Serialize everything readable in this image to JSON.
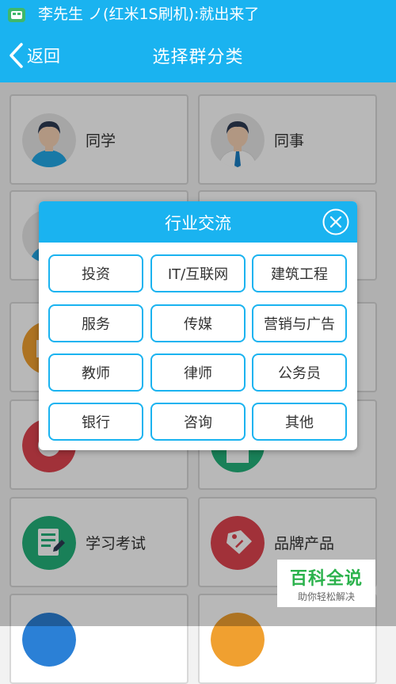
{
  "status_bar": {
    "notification": "李先生 ノ(红米1S刷机):就出来了"
  },
  "nav": {
    "back_label": "返回",
    "title": "选择群分类"
  },
  "categories": [
    {
      "label": "同学"
    },
    {
      "label": "同事"
    },
    {
      "label": "学习考试"
    },
    {
      "label": "品牌产品"
    }
  ],
  "dialog": {
    "title": "行业交流",
    "options": [
      "投资",
      "IT/互联网",
      "建筑工程",
      "服务",
      "传媒",
      "营销与广告",
      "教师",
      "律师",
      "公务员",
      "银行",
      "咨询",
      "其他"
    ]
  },
  "watermark": {
    "main": "百科全说",
    "sub": "助你轻松解决"
  },
  "colors": {
    "accent": "#1ab3f0",
    "watermark_green": "#2bb24c"
  }
}
